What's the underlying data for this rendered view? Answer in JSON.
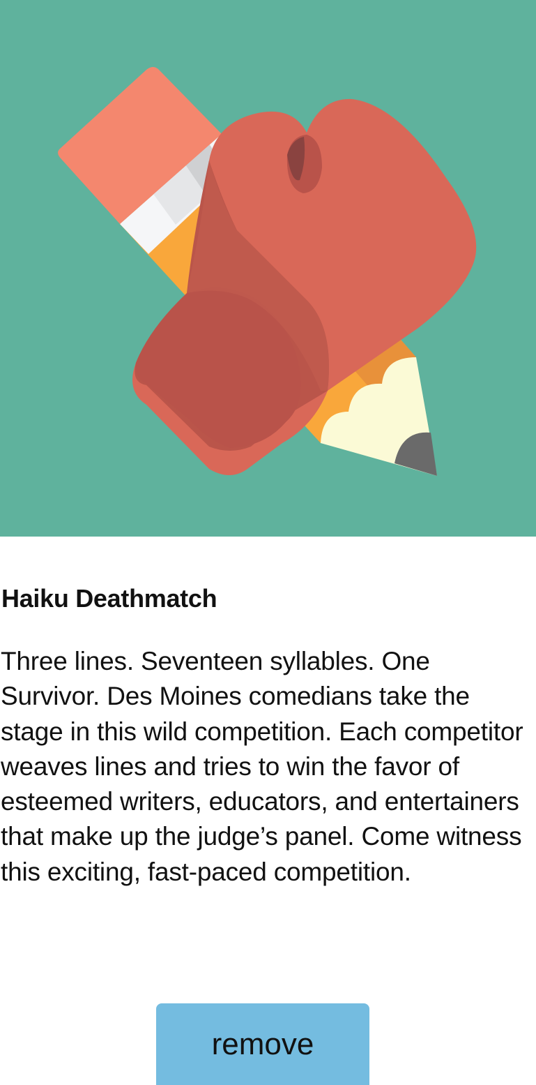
{
  "event": {
    "title": "Haiku Deathmatch",
    "description": "Three lines. Seventeen syllables. One Survivor. Des Moines comedians take the stage in this wild competition. Each competitor weaves lines and tries to win the favor of esteemed writers, educators, and entertainers that make up the judge’s panel. Come witness this exciting, fast-paced competition.",
    "image_icon": "boxing-glove-pencil-icon"
  },
  "actions": {
    "remove_label": "remove"
  },
  "colors": {
    "hero_background": "#5fb29d",
    "button_background": "#74bce0"
  }
}
